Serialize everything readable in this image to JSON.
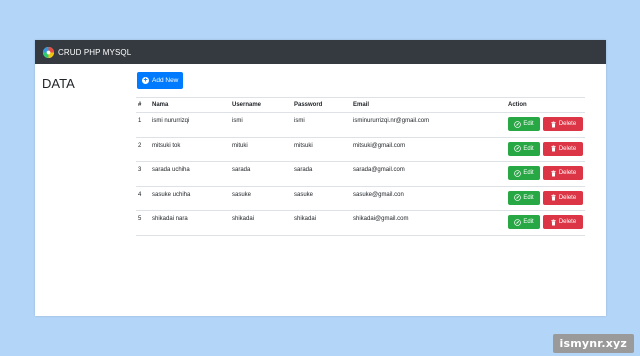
{
  "navbar": {
    "brand_text": "CRUD PHP MYSQL",
    "logo_icon": "brand-logo-icon"
  },
  "sidebar": {
    "title": "DATA"
  },
  "toolbar": {
    "add_label": "Add New",
    "add_icon": "plus-circle-icon"
  },
  "table": {
    "headers": {
      "no": "#",
      "nama": "Nama",
      "username": "Username",
      "password": "Password",
      "email": "Email",
      "action": "Action"
    },
    "rows": [
      {
        "no": "1",
        "nama": "ismi nururrizqi",
        "username": "ismi",
        "password": "ismi",
        "email": "isminururrizqi.nr@gmail.com"
      },
      {
        "no": "2",
        "nama": "mitsuki tok",
        "username": "mituki",
        "password": "mitsuki",
        "email": "mitsuki@gmail.com"
      },
      {
        "no": "3",
        "nama": "sarada uchiha",
        "username": "sarada",
        "password": "sarada",
        "email": "sarada@gmail.com"
      },
      {
        "no": "4",
        "nama": "sasuke uchiha",
        "username": "sasuke",
        "password": "sasuke",
        "email": "sasuke@gmail.con"
      },
      {
        "no": "5",
        "nama": "shikadai nara",
        "username": "shikadai",
        "password": "shikadai",
        "email": "shikadai@gmail.com"
      }
    ],
    "edit_label": "Edit",
    "delete_label": "Delete"
  },
  "colors": {
    "navbar": "#343a40",
    "primary": "#007bff",
    "success": "#28a745",
    "danger": "#dc3545",
    "background": "#b3d5f7"
  },
  "watermark": {
    "text": "ismynr.xyz"
  }
}
